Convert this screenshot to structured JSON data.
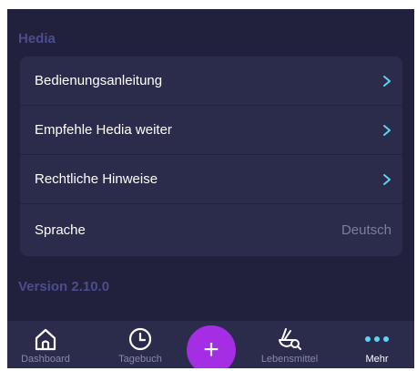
{
  "section": {
    "title": "Hedia"
  },
  "menu": {
    "items": [
      {
        "label": "Bedienungsanleitung"
      },
      {
        "label": "Empfehle Hedia weiter"
      },
      {
        "label": "Rechtliche Hinweise"
      },
      {
        "label": "Sprache",
        "value": "Deutsch"
      }
    ]
  },
  "version": {
    "label": "Version 2.10.0"
  },
  "tabbar": {
    "tabs": [
      {
        "label": "Dashboard",
        "icon": "home-icon"
      },
      {
        "label": "Tagebuch",
        "icon": "clock-icon"
      },
      {
        "label": "Lebensmittel",
        "icon": "food-search-icon"
      },
      {
        "label": "Mehr",
        "icon": "more-dots-icon",
        "active": true
      }
    ],
    "add": {
      "label": "+"
    }
  },
  "colors": {
    "background": "#21213d",
    "card": "#2b2b4b",
    "accent_cyan": "#5fd3f3",
    "accent_purple": "#a52de4",
    "muted_title": "#4d4d8c"
  }
}
